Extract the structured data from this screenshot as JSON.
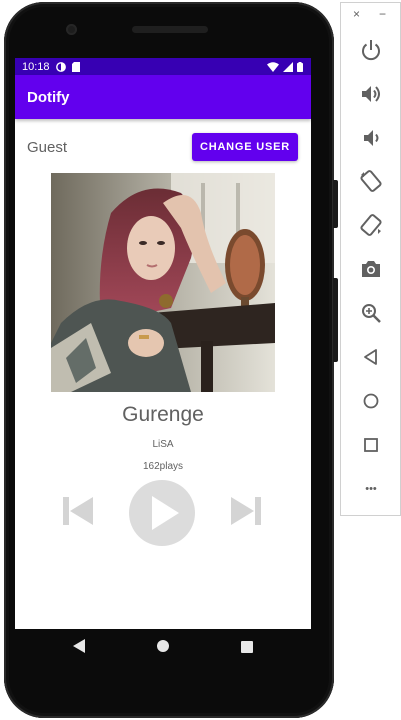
{
  "status_bar": {
    "time": "10:18"
  },
  "app_bar": {
    "title": "Dotify"
  },
  "user": {
    "name": "Guest",
    "change_button_label": "CHANGE USER"
  },
  "song": {
    "title": "Gurenge",
    "artist": "LiSA",
    "plays": "162plays"
  },
  "controls": {
    "prev_icon": "skip-previous-icon",
    "play_icon": "play-icon",
    "next_icon": "skip-next-icon"
  },
  "emulator_toolbar": {
    "close_glyph": "×",
    "minimize_glyph": "−",
    "more_glyph": "•••",
    "buttons": [
      "power-icon",
      "volume-up-icon",
      "volume-down-icon",
      "rotate-left-icon",
      "rotate-right-icon",
      "camera-icon",
      "zoom-icon",
      "back-icon",
      "home-icon",
      "overview-icon",
      "more-icon"
    ]
  },
  "colors": {
    "primary": "#6200ee",
    "primary_dark": "#3700b3",
    "text_secondary": "#616161",
    "control_gray": "#d4d4d4"
  }
}
